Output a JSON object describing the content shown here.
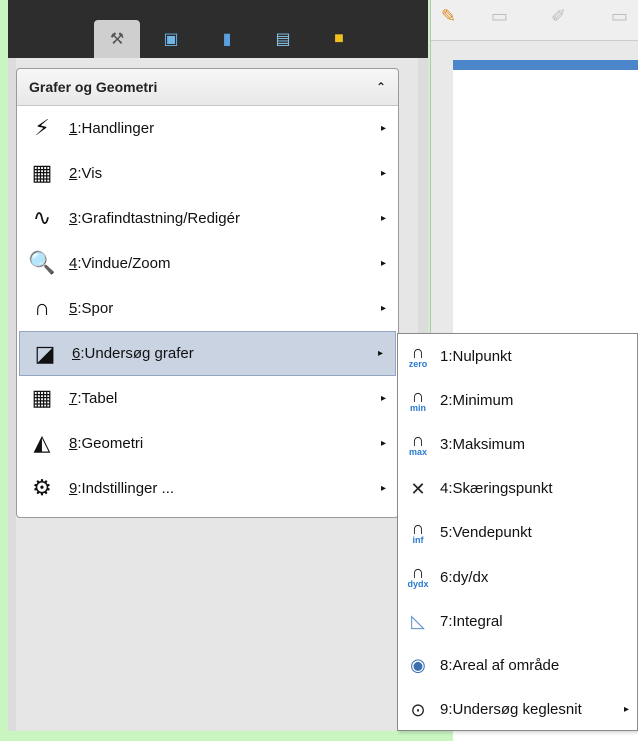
{
  "toolbar": {
    "tabs": [
      {
        "icon": "tools-icon",
        "glyph": "⚒"
      },
      {
        "icon": "document-browser-icon",
        "glyph": "▣"
      },
      {
        "icon": "variables-icon",
        "glyph": "▮"
      },
      {
        "icon": "library-icon",
        "glyph": "▤"
      },
      {
        "icon": "folder-icon",
        "glyph": "■"
      }
    ]
  },
  "menu": {
    "title": "Grafer og Geometri",
    "collapse_glyph": "⌃",
    "items": [
      {
        "num": "1",
        "label": "Handlinger",
        "icon": "lightning-icon",
        "glyph": "⚡"
      },
      {
        "num": "2",
        "label": "Vis",
        "icon": "view-icon",
        "glyph": "▦"
      },
      {
        "num": "3",
        "label": "Grafindtastning/Redigér",
        "icon": "graph-entry-icon",
        "glyph": "∿"
      },
      {
        "num": "4",
        "label": "Vindue/Zoom",
        "icon": "magnifier-icon",
        "glyph": "🔍"
      },
      {
        "num": "5",
        "label": "Spor",
        "icon": "trace-icon",
        "glyph": "∩"
      },
      {
        "num": "6",
        "label": "Undersøg grafer",
        "icon": "analyze-graph-icon",
        "glyph": "◪"
      },
      {
        "num": "7",
        "label": "Tabel",
        "icon": "table-icon",
        "glyph": "▦"
      },
      {
        "num": "8",
        "label": "Geometri",
        "icon": "geometry-icon",
        "glyph": "◭"
      },
      {
        "num": "9",
        "label": "Indstillinger ...",
        "icon": "gear-icon",
        "glyph": "⚙"
      }
    ],
    "arrow_glyph": "▸"
  },
  "submenu": {
    "items": [
      {
        "label": "1:Nulpunkt",
        "icon": "zero-icon",
        "sub": "zero"
      },
      {
        "label": "2:Minimum",
        "icon": "minimum-icon",
        "sub": "min"
      },
      {
        "label": "3:Maksimum",
        "icon": "maximum-icon",
        "sub": "max"
      },
      {
        "label": "4:Skæringspunkt",
        "icon": "intersection-icon",
        "sub": ""
      },
      {
        "label": "5:Vendepunkt",
        "icon": "inflection-icon",
        "sub": "inf"
      },
      {
        "label": "6:dy/dx",
        "icon": "dydx-icon",
        "sub": "dydx"
      },
      {
        "label": "7:Integral",
        "icon": "integral-icon",
        "sub": ""
      },
      {
        "label": "8:Areal af område",
        "icon": "area-icon",
        "sub": ""
      },
      {
        "label": "9:Undersøg keglesnit",
        "icon": "conic-icon",
        "sub": ""
      }
    ]
  },
  "colors": {
    "background": "#c8f5c0",
    "accent": "#2a7bd1",
    "selected": "#c9d3e2"
  }
}
